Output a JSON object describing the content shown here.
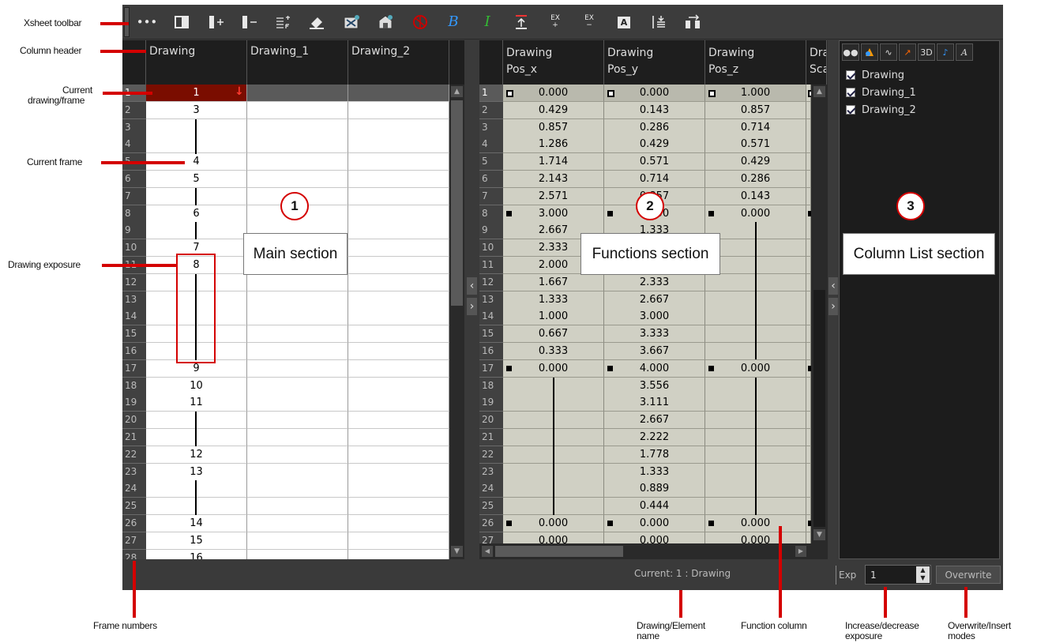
{
  "callouts": {
    "xsheet_toolbar": "Xsheet toolbar",
    "column_header": "Column header",
    "current_drawing_frame_1": "Current",
    "current_drawing_frame_2": "drawing/frame",
    "current_frame": "Current frame",
    "drawing_exposure": "Drawing exposure",
    "frame_numbers": "Frame numbers",
    "drawing_element_name_1": "Drawing/Element",
    "drawing_element_name_2": "name",
    "function_column": "Function column",
    "increase_decrease_1": "Increase/decrease",
    "increase_decrease_2": "exposure",
    "overwrite_insert_1": "Overwrite/Insert",
    "overwrite_insert_2": "modes"
  },
  "toolbar": {
    "icons": [
      "dots-icon",
      "single-column-icon",
      "add-column-icon",
      "remove-column-icon",
      "sequence-fill-icon",
      "clear-icon",
      "create-drawing-icon",
      "duplicate-drawing-icon",
      "onion-skin-icon",
      "brush-B-icon",
      "ink-I-icon",
      "insert-blank-icon",
      "ex-plus",
      "ex-minus",
      "label-A-icon",
      "set-key-icon",
      "move-icon"
    ],
    "ex_label": "EX",
    "plus": "+",
    "minus": "−",
    "a_label": "A"
  },
  "main": {
    "columns": [
      "Drawing",
      "Drawing_1",
      "Drawing_2"
    ],
    "frame_numbers": [
      "1",
      "2",
      "3",
      "4",
      "5",
      "6",
      "7",
      "8",
      "9",
      "10",
      "11",
      "12",
      "13",
      "14",
      "15",
      "16",
      "17",
      "18",
      "19",
      "20",
      "21",
      "22",
      "23",
      "24",
      "25",
      "26",
      "27",
      "28"
    ],
    "drawing_values": {
      "1": "1",
      "2": "3",
      "5": "4",
      "6": "5",
      "8": "6",
      "10": "7",
      "11": "8",
      "17": "9",
      "18": "10",
      "19": "11",
      "22": "12",
      "23": "13",
      "26": "14",
      "27": "15",
      "28": "16"
    },
    "section_number": "1",
    "section_label": "Main section"
  },
  "functions": {
    "headers": [
      {
        "line1": "Drawing",
        "line2": "Pos_x"
      },
      {
        "line1": "Drawing",
        "line2": "Pos_y"
      },
      {
        "line1": "Drawing",
        "line2": "Pos_z"
      },
      {
        "line1": "Dra",
        "line2": "Sca"
      }
    ],
    "pos_x": [
      "0.000",
      "0.429",
      "0.857",
      "1.286",
      "1.714",
      "2.143",
      "2.571",
      "3.000",
      "2.667",
      "2.333",
      "2.000",
      "1.667",
      "1.333",
      "1.000",
      "0.667",
      "0.333",
      "0.000",
      "",
      "",
      "",
      "",
      "",
      "",
      "",
      "",
      "0.000",
      "0.000"
    ],
    "pos_y": [
      "0.000",
      "0.143",
      "0.286",
      "0.429",
      "0.571",
      "0.714",
      "0.857",
      "3.000",
      "1.333",
      "1.667",
      "2.000",
      "2.333",
      "2.667",
      "3.000",
      "3.333",
      "3.667",
      "4.000",
      "3.556",
      "3.111",
      "2.667",
      "2.222",
      "1.778",
      "1.333",
      "0.889",
      "0.444",
      "0.000",
      "0.000"
    ],
    "pos_z": [
      "1.000",
      "0.857",
      "0.714",
      "0.571",
      "0.429",
      "0.286",
      "0.143",
      "0.000",
      "",
      "",
      "",
      "",
      "",
      "",
      "",
      "",
      "0.000",
      "",
      "",
      "",
      "",
      "",
      "",
      "",
      "",
      "0.000",
      "0.000"
    ],
    "section_number": "2",
    "section_label": "Functions section"
  },
  "column_list": {
    "icons": [
      "eyes-icon",
      "color-icon",
      "curve-icon",
      "pen-icon",
      "3d-icon",
      "sound-icon",
      "text-icon"
    ],
    "label_3d": "3D",
    "items": [
      "Drawing",
      "Drawing_1",
      "Drawing_2"
    ],
    "section_number": "3",
    "section_label": "Column List section"
  },
  "statusbar": {
    "current": "Current: 1 : Drawing",
    "exp_label": "Exp",
    "exp_value": "1",
    "mode_button": "Overwrite"
  },
  "colors": {
    "current_frame": "#7a0d00",
    "accent_red": "#d40000",
    "function_cell": "#d0d0c4"
  }
}
